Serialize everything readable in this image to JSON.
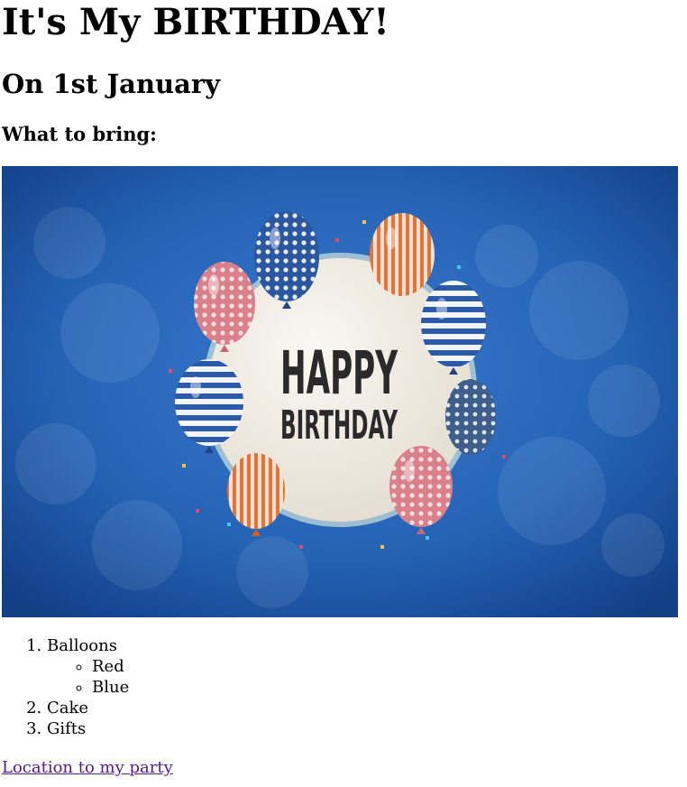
{
  "page": {
    "title": "It's My BIRTHDAY!",
    "date": "On 1st January",
    "bring_heading": "What to bring:"
  },
  "banner": {
    "line1": "HAPPY",
    "line2": "BIRTHDAY",
    "background_color": "#1f5aa6",
    "circle_color": "#f1ece3",
    "text_color": "#2a2a2a"
  },
  "list": {
    "items": [
      {
        "label": "Balloons",
        "sub": [
          "Red",
          "Blue"
        ]
      },
      {
        "label": "Cake"
      },
      {
        "label": "Gifts"
      }
    ]
  },
  "link": {
    "text": "Location to my party",
    "color": "#551a8b"
  }
}
